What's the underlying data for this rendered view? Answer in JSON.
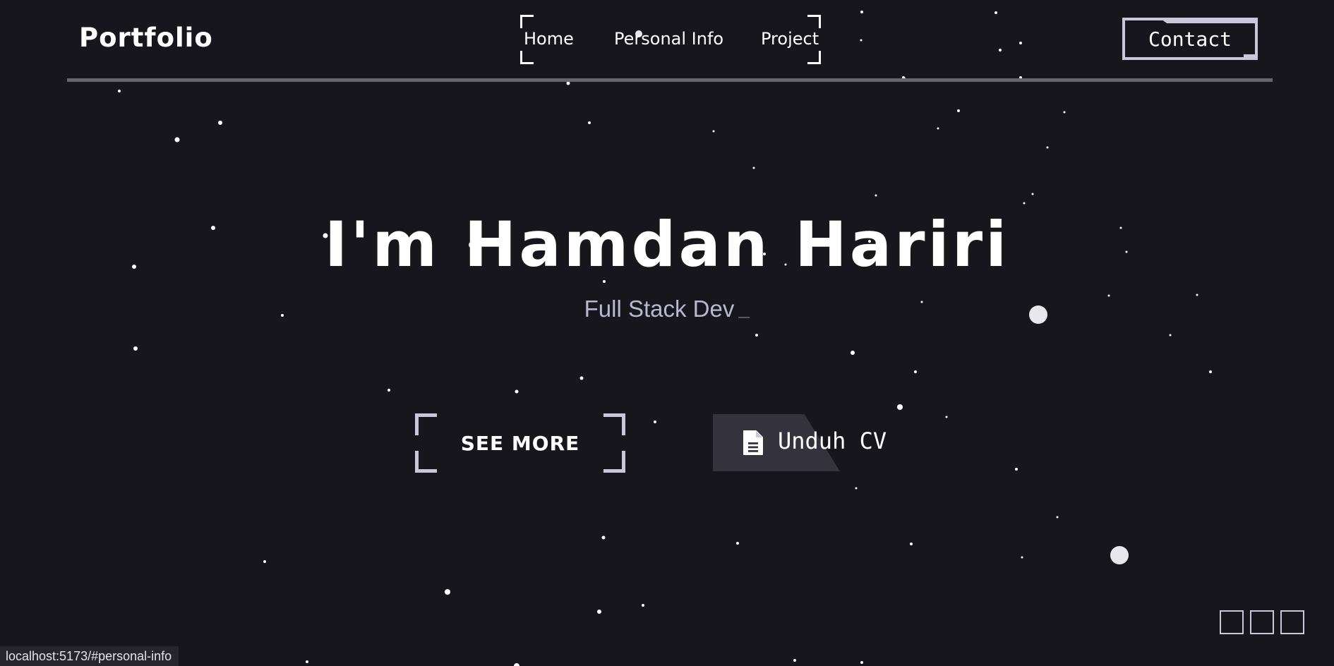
{
  "brand": {
    "logo": "Portfolio"
  },
  "nav": {
    "items": [
      {
        "label": "Home"
      },
      {
        "label": "Personal Info"
      },
      {
        "label": "Project"
      }
    ],
    "contact_label": "Contact"
  },
  "hero": {
    "title": "I'm Hamdan Hariri",
    "subtitle": "Full Stack Dev",
    "see_more_label": "SEE MORE",
    "download_cv_label": "Unduh CV"
  },
  "icons": {
    "cv": "file-document-icon"
  },
  "status_bar": {
    "url": "localhost:5173/#personal-info"
  },
  "colors": {
    "background": "#17161d",
    "accent": "#c9c8da",
    "subtitle": "#b9b8d1",
    "divider": "#65646f",
    "cv_button": "#34333d"
  }
}
